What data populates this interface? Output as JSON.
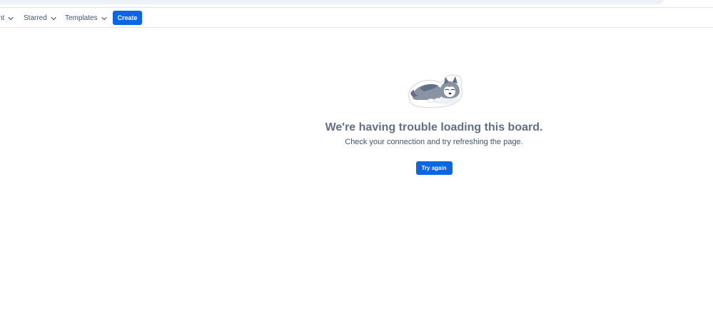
{
  "nav": {
    "items": [
      {
        "label": "nt",
        "icon": "chevron-down-icon"
      },
      {
        "label": "Starred",
        "icon": "chevron-down-icon"
      },
      {
        "label": "Templates",
        "icon": "chevron-down-icon"
      }
    ],
    "create_label": "Create"
  },
  "error": {
    "illustration_icon": "sleeping-husky-illustration",
    "title": "We're having trouble loading this board.",
    "message": "Check your connection and try refreshing the page.",
    "retry_label": "Try again"
  },
  "colors": {
    "accent": "#0c66e4",
    "title_text": "#626f86",
    "body_text": "#44546f"
  }
}
